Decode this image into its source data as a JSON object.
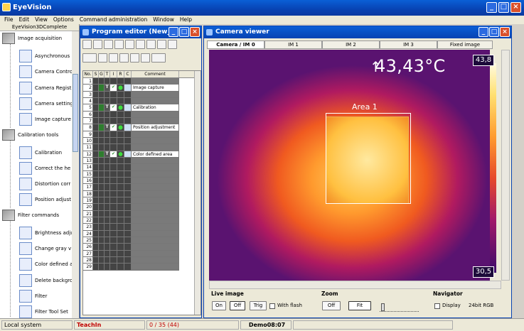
{
  "app": {
    "title": "EyeVision"
  },
  "menu": [
    "File",
    "Edit",
    "View",
    "Options",
    "Command administration",
    "Window",
    "Help"
  ],
  "sidebar": {
    "header": "EyeVision3DComplete",
    "items": [
      {
        "label": "Image acquisition",
        "kind": "category",
        "icon": "camera-category-icon"
      },
      {
        "label": "Asynchronous",
        "kind": "command",
        "icon": "async-icon"
      },
      {
        "label": "Camera Contro",
        "kind": "command",
        "icon": "camera-control-icon"
      },
      {
        "label": "Camera Regist",
        "kind": "command",
        "icon": "firewire-icon"
      },
      {
        "label": "Camera setting",
        "kind": "command",
        "icon": "camera-setting-icon"
      },
      {
        "label": "Image capture",
        "kind": "command",
        "icon": "image-capture-icon"
      },
      {
        "label": "Calibration tools",
        "kind": "category",
        "icon": "calibration-category-icon"
      },
      {
        "label": "Calibration",
        "kind": "command",
        "icon": "calibration-icon"
      },
      {
        "label": "Correct the he",
        "kind": "command",
        "icon": "correct-height-icon"
      },
      {
        "label": "Distortion corr",
        "kind": "command",
        "icon": "distortion-icon"
      },
      {
        "label": "Position adjust",
        "kind": "command",
        "icon": "position-adjust-icon"
      },
      {
        "label": "Filter commands",
        "kind": "category",
        "icon": "filter-category-icon"
      },
      {
        "label": "Brightness adju",
        "kind": "command",
        "icon": "brightness-icon"
      },
      {
        "label": "Change gray v",
        "kind": "command",
        "icon": "gray-value-icon"
      },
      {
        "label": "Color defined a",
        "kind": "command",
        "icon": "color-area-icon"
      },
      {
        "label": "Delete backgro",
        "kind": "command",
        "icon": "delete-background-icon"
      },
      {
        "label": "Filter",
        "kind": "command",
        "icon": "filter-icon"
      },
      {
        "label": "Filter Tool Set",
        "kind": "command",
        "icon": "filter-toolset-icon"
      }
    ]
  },
  "program_editor": {
    "title": "Program editor (New_...",
    "columns": [
      "No.",
      "S",
      "G",
      "T",
      "I",
      "R",
      "C",
      "Comment"
    ],
    "rows": [
      {
        "no": "1",
        "comment": ""
      },
      {
        "no": "2",
        "comment": "Image capture"
      },
      {
        "no": "3",
        "comment": ""
      },
      {
        "no": "4",
        "comment": ""
      },
      {
        "no": "5",
        "comment": "Calibration"
      },
      {
        "no": "6",
        "comment": ""
      },
      {
        "no": "7",
        "comment": ""
      },
      {
        "no": "8",
        "comment": "Position adjustment"
      },
      {
        "no": "9",
        "comment": ""
      },
      {
        "no": "10",
        "comment": ""
      },
      {
        "no": "11",
        "comment": ""
      },
      {
        "no": "12",
        "comment": "Color defined area"
      },
      {
        "no": "13",
        "comment": ""
      },
      {
        "no": "14",
        "comment": ""
      },
      {
        "no": "15",
        "comment": ""
      },
      {
        "no": "16",
        "comment": ""
      },
      {
        "no": "17",
        "comment": ""
      },
      {
        "no": "18",
        "comment": ""
      },
      {
        "no": "19",
        "comment": ""
      },
      {
        "no": "20",
        "comment": ""
      },
      {
        "no": "21",
        "comment": ""
      },
      {
        "no": "22",
        "comment": ""
      },
      {
        "no": "23",
        "comment": ""
      },
      {
        "no": "24",
        "comment": ""
      },
      {
        "no": "25",
        "comment": ""
      },
      {
        "no": "26",
        "comment": ""
      },
      {
        "no": "27",
        "comment": ""
      },
      {
        "no": "28",
        "comment": ""
      },
      {
        "no": "29",
        "comment": ""
      }
    ]
  },
  "camera_viewer": {
    "title": "Camera viewer",
    "tabs": [
      "Camera / IM 0",
      "IM 1",
      "IM 2",
      "IM 3",
      "Fixed image"
    ],
    "active_tab": 0,
    "temperature": "43,43°C",
    "area_label": "Area 1",
    "scale_max": "43,8",
    "scale_min": "30,5"
  },
  "controls": {
    "live_image": {
      "label": "Live image",
      "on": "On",
      "off": "Off",
      "trig": "Trig",
      "flash": "With flash"
    },
    "zoom": {
      "label": "Zoom",
      "off": "Off",
      "fit": "Fit"
    },
    "navigator": {
      "label": "Navigator",
      "display": "Display",
      "format": "24bit RGB"
    }
  },
  "status": {
    "system": "Local system",
    "mode": "TeachIn",
    "count": "0 / 35 (44)",
    "demo": "Demo08:07"
  }
}
